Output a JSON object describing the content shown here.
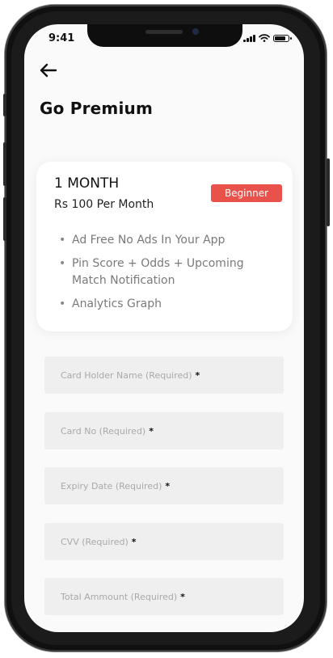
{
  "status_bar": {
    "time": "9:41",
    "signal_icon": "cellular-signal-icon",
    "wifi_icon": "wifi-icon",
    "battery_icon": "battery-icon",
    "battery_level": 0.85
  },
  "header": {
    "back_icon": "arrow-left-icon",
    "title": "Go Premium"
  },
  "plan": {
    "name": "1 MONTH",
    "price": "Rs 100 Per Month",
    "badge": "Beginner",
    "badge_color": "#e8524a",
    "features": [
      "Ad Free No Ads In Your App",
      "Pin Score + Odds + Upcoming Match Notification",
      "Analytics Graph"
    ]
  },
  "form": {
    "required_marker": "*",
    "fields": [
      {
        "placeholder": "Card Holder Name (Required)"
      },
      {
        "placeholder": "Card No (Required)"
      },
      {
        "placeholder": "Expiry Date (Required)"
      },
      {
        "placeholder": "CVV (Required)"
      },
      {
        "placeholder": "Total Ammount (Required)"
      }
    ]
  }
}
